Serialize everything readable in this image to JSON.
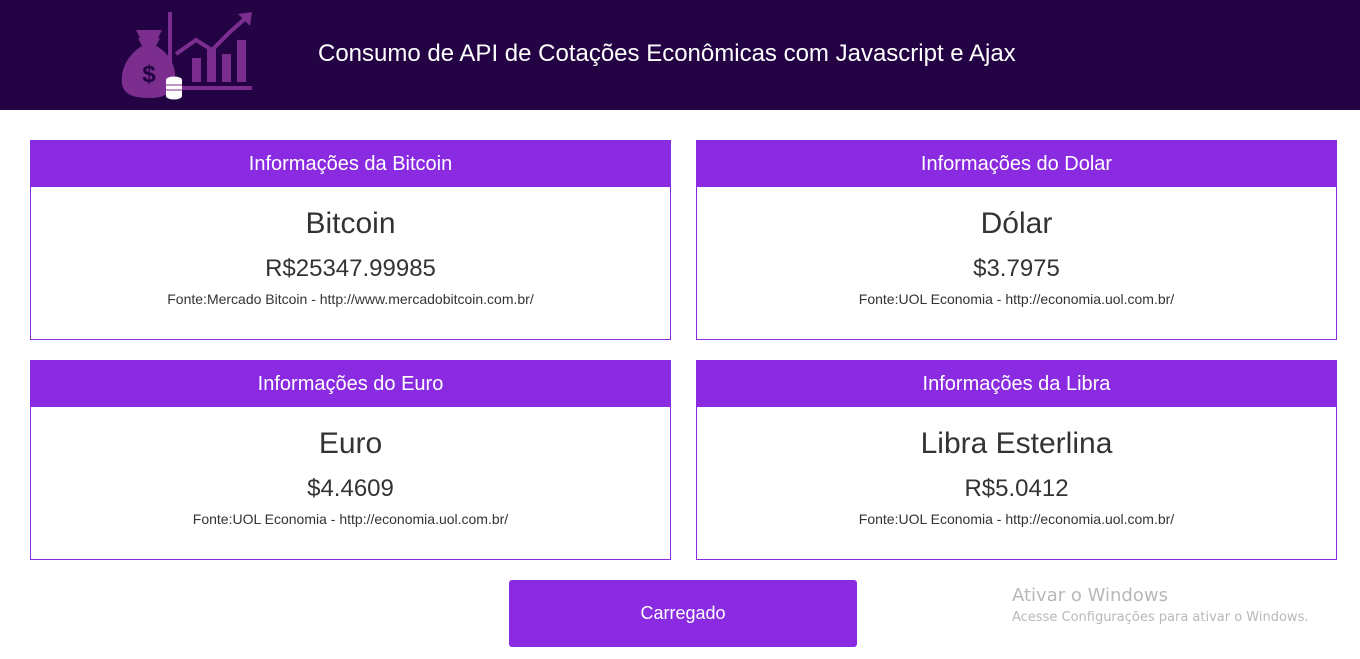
{
  "header": {
    "title": "Consumo de API de Cotações Econômicas com Javascript e Ajax",
    "logo_icon": "money-bag-chart-icon"
  },
  "cards": {
    "bitcoin": {
      "heading": "Informações da Bitcoin",
      "name": "Bitcoin",
      "value": "R$25347.99985",
      "source": "Fonte:Mercado Bitcoin - http://www.mercadobitcoin.com.br/"
    },
    "dolar": {
      "heading": "Informações do Dolar",
      "name": "Dólar",
      "value": "$3.7975",
      "source": "Fonte:UOL Economia - http://economia.uol.com.br/"
    },
    "euro": {
      "heading": "Informações do Euro",
      "name": "Euro",
      "value": "$4.4609",
      "source": "Fonte:UOL Economia - http://economia.uol.com.br/"
    },
    "libra": {
      "heading": "Informações da Libra",
      "name": "Libra Esterlina",
      "value": "R$5.0412",
      "source": "Fonte:UOL Economia - http://economia.uol.com.br/"
    }
  },
  "button": {
    "label": "Carregado"
  },
  "watermark": {
    "title": "Ativar o Windows",
    "subtitle": "Acesse Configurações para ativar o Windows."
  },
  "colors": {
    "header_bg": "#230343",
    "accent": "#8a2be2",
    "logo": "#7b2e8e"
  }
}
